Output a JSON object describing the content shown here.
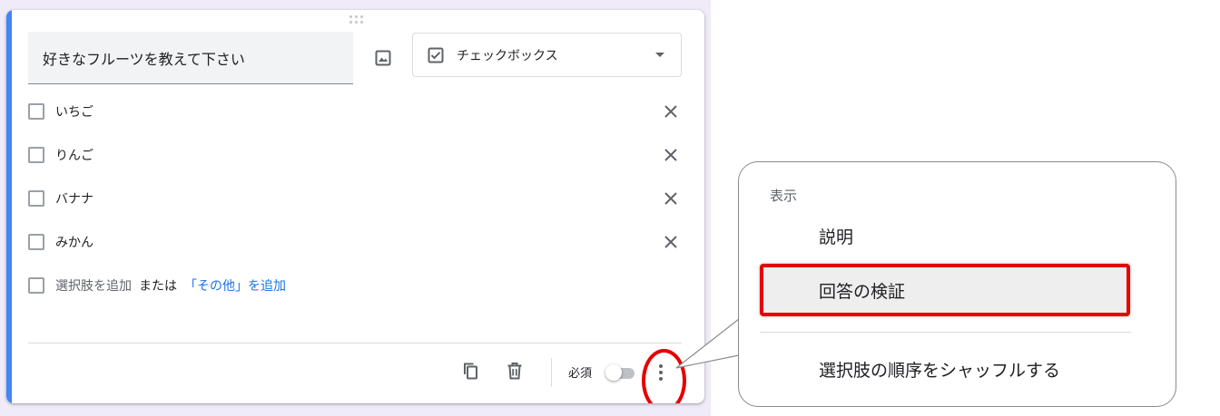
{
  "question": {
    "title": "好きなフルーツを教えて下さい",
    "type_label": "チェックボックス"
  },
  "options": [
    {
      "label": "いちご"
    },
    {
      "label": "りんご"
    },
    {
      "label": "バナナ"
    },
    {
      "label": "みかん"
    }
  ],
  "add_row": {
    "add_label": "選択肢を追加",
    "or_text": "または",
    "add_other": "「その他」を追加"
  },
  "footer": {
    "required_label": "必須",
    "required_on": false
  },
  "menu": {
    "heading": "表示",
    "items": [
      {
        "label": "説明"
      },
      {
        "label": "回答の検証"
      },
      {
        "label": "選択肢の順序をシャッフルする"
      }
    ]
  },
  "colors": {
    "accent": "#4285f4",
    "link": "#1a73e8",
    "highlight": "#e60000"
  }
}
